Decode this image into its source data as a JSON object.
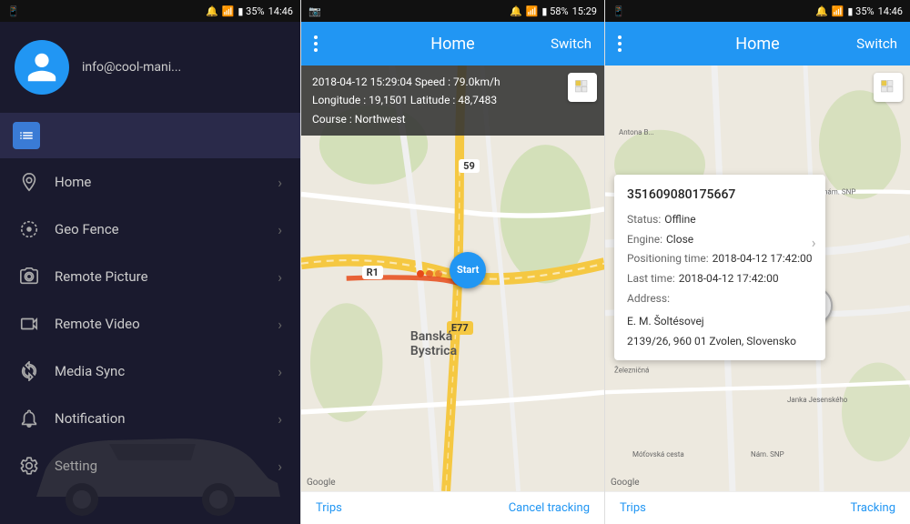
{
  "panel1": {
    "status_bar": {
      "left": "📱",
      "icons": "🔔 📶 🔋 35%",
      "time": "14:46"
    },
    "header": {
      "email": "info@cool-mani..."
    },
    "menu_items": [
      {
        "id": "home",
        "label": "Home",
        "icon": "location"
      },
      {
        "id": "geo-fence",
        "label": "Geo Fence",
        "icon": "geo"
      },
      {
        "id": "remote-picture",
        "label": "Remote Picture",
        "icon": "camera"
      },
      {
        "id": "remote-video",
        "label": "Remote Video",
        "icon": "video"
      },
      {
        "id": "media-sync",
        "label": "Media Sync",
        "icon": "sync"
      },
      {
        "id": "notification",
        "label": "Notification",
        "icon": "bell"
      },
      {
        "id": "setting",
        "label": "Setting",
        "icon": "settings"
      }
    ]
  },
  "panel2": {
    "status_bar": {
      "icons": "📷 🔔 📶 🔋 58%",
      "time": "15:29"
    },
    "header": {
      "title": "Home",
      "switch_label": "Switch"
    },
    "trip_info": {
      "line1": "2018-04-12 15:29:04   Speed : 79.0km/h",
      "line2": "Longitude : 19,1501   Latitude : 48,7483",
      "line3": "Course : Northwest"
    },
    "map": {
      "road_label": "R1",
      "e77_label": "E77",
      "e59_label": "59",
      "city_label": "Banská\nBystrica",
      "start_label": "Start"
    },
    "bottom_bar": {
      "left_link": "Trips",
      "right_link": "Cancel tracking"
    }
  },
  "panel3": {
    "status_bar": {
      "icons": "🔔 📶 🔋 35%",
      "time": "14:46"
    },
    "header": {
      "title": "Home",
      "switch_label": "Switch"
    },
    "info_popup": {
      "device_id": "351609080175667",
      "status_key": "Status:",
      "status_val": "Offline",
      "engine_key": "Engine:",
      "engine_val": "Close",
      "positioning_key": "Positioning time:",
      "positioning_val": "2018-04-12 17:42:00",
      "last_key": "Last time:",
      "last_val": "2018-04-12 17:42:00",
      "address_key": "Address:",
      "address_val": "E. M. Šoltésovej\n2139/26, 960 01 Zvolen, Slovensko"
    },
    "bottom_bar": {
      "left_link": "Trips",
      "right_link": "Tracking"
    }
  },
  "colors": {
    "blue": "#2196F3",
    "dark_bg": "#1a1a2e",
    "header_blue": "#2196F3"
  }
}
